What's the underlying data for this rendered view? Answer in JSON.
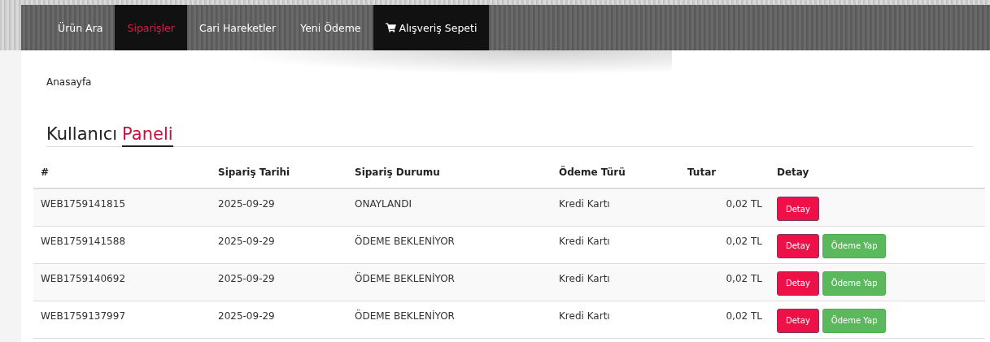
{
  "nav": {
    "items": [
      {
        "label": "Ürün Ara",
        "selected": false,
        "highlighted": false
      },
      {
        "label": "Siparişler",
        "selected": true,
        "highlighted": false
      },
      {
        "label": "Cari Hareketler",
        "selected": false,
        "highlighted": false
      },
      {
        "label": "Yeni Ödeme",
        "selected": false,
        "highlighted": false
      },
      {
        "label": "Alışveriş Sepeti",
        "selected": false,
        "highlighted": true,
        "kind": "cart"
      }
    ]
  },
  "breadcrumb": "Anasayfa",
  "heading": {
    "text": "Kullanıcı",
    "accent": "Paneli"
  },
  "table": {
    "columns": [
      "#",
      "Sipariş Tarihi",
      "Sipariş Durumu",
      "Ödeme Türü",
      "Tutar",
      "Detay"
    ],
    "rows": [
      {
        "cells": [
          "WEB1759141815",
          "2025-09-29",
          "ONAYLANDI",
          "Kredi Kartı",
          "0,02 TL"
        ],
        "buttons": [
          {
            "label": "Detay",
            "kind": "detail"
          }
        ]
      },
      {
        "cells": [
          "WEB1759141588",
          "2025-09-29",
          "ÖDEME BEKLENİYOR",
          "Kredi Kartı",
          "0,02 TL"
        ],
        "buttons": [
          {
            "label": "Detay",
            "kind": "detail"
          },
          {
            "label": "Ödeme Yap",
            "kind": "pay"
          }
        ]
      },
      {
        "cells": [
          "WEB1759140692",
          "2025-09-29",
          "ÖDEME BEKLENİYOR",
          "Kredi Kartı",
          "0,02 TL"
        ],
        "buttons": [
          {
            "label": "Detay",
            "kind": "detail"
          },
          {
            "label": "Ödeme Yap",
            "kind": "pay"
          }
        ]
      },
      {
        "cells": [
          "WEB1759137997",
          "2025-09-29",
          "ÖDEME BEKLENİYOR",
          "Kredi Kartı",
          "0,02 TL"
        ],
        "buttons": [
          {
            "label": "Detay",
            "kind": "detail"
          },
          {
            "label": "Ödeme Yap",
            "kind": "pay"
          }
        ]
      }
    ]
  }
}
